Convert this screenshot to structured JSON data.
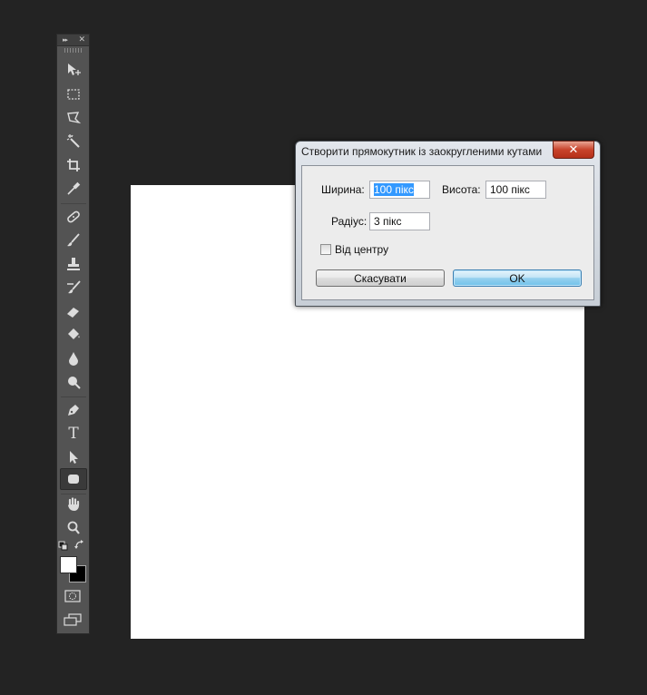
{
  "toolbar": {
    "tools": [
      {
        "name": "move-tool",
        "icon": "move-icon"
      },
      {
        "name": "marquee-tool",
        "icon": "rect-marquee-icon"
      },
      {
        "name": "lasso-tool",
        "icon": "polygonal-lasso-icon"
      },
      {
        "name": "magic-wand-tool",
        "icon": "magic-wand-icon"
      },
      {
        "name": "crop-tool",
        "icon": "crop-icon"
      },
      {
        "name": "eyedropper-tool",
        "icon": "eyedropper-icon"
      },
      {
        "name": "healing-brush-tool",
        "icon": "bandage-icon"
      },
      {
        "name": "brush-tool",
        "icon": "brush-icon"
      },
      {
        "name": "clone-stamp-tool",
        "icon": "stamp-icon"
      },
      {
        "name": "history-brush-tool",
        "icon": "history-brush-icon"
      },
      {
        "name": "eraser-tool",
        "icon": "eraser-icon"
      },
      {
        "name": "paint-bucket-tool",
        "icon": "bucket-icon"
      },
      {
        "name": "blur-tool",
        "icon": "drop-icon"
      },
      {
        "name": "dodge-tool",
        "icon": "dodge-icon"
      },
      {
        "name": "pen-tool",
        "icon": "pen-icon"
      },
      {
        "name": "type-tool",
        "icon": "type-icon",
        "glyph": "T"
      },
      {
        "name": "path-selection-tool",
        "icon": "arrow-icon"
      },
      {
        "name": "rounded-rectangle-tool",
        "icon": "rounded-rect-icon",
        "active": true
      },
      {
        "name": "hand-tool",
        "icon": "hand-icon"
      },
      {
        "name": "zoom-tool",
        "icon": "zoom-icon"
      }
    ],
    "collapse_glyph": "▸▸",
    "close_glyph": "✕"
  },
  "colors": {
    "foreground": "#ffffff",
    "background": "#000000",
    "accent": "#3399ff",
    "workspace": "#232323"
  },
  "dialog": {
    "title": "Створити прямокутник із заокругленими кутами",
    "close_glyph": "✕",
    "width_label": "Ширина:",
    "width_value": "100 пікс",
    "height_label": "Висота:",
    "height_value": "100 пікс",
    "radius_label": "Радіус:",
    "radius_value": "3 пікс",
    "from_center_label": "Від центру",
    "from_center_checked": false,
    "cancel_label": "Скасувати",
    "ok_label": "OK"
  }
}
